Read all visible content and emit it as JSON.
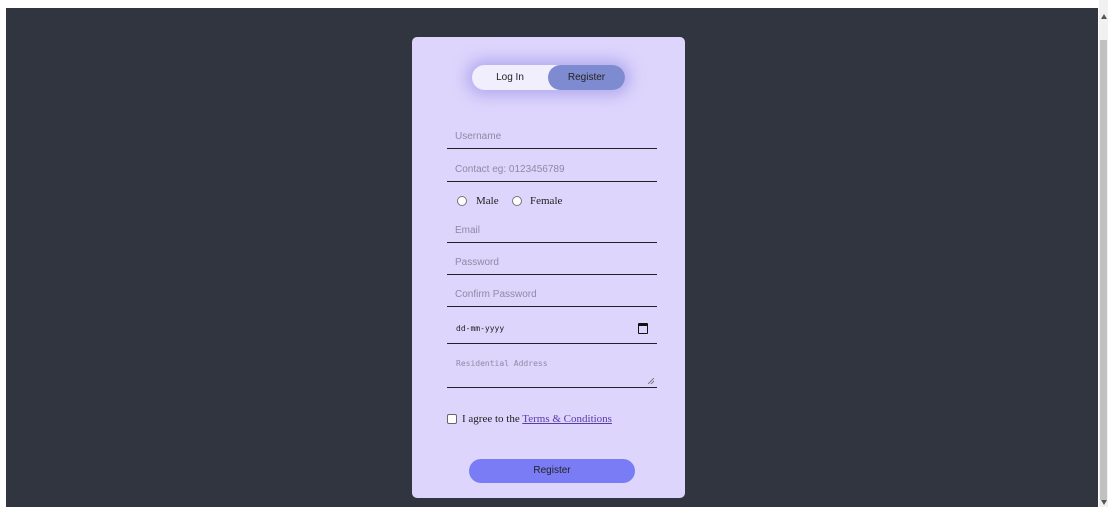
{
  "toggle": {
    "login_label": "Log In",
    "register_label": "Register"
  },
  "form": {
    "username_placeholder": "Username",
    "contact_placeholder": "Contact eg: 0123456789",
    "gender": {
      "male_label": "Male",
      "female_label": "Female"
    },
    "email_placeholder": "Email",
    "password_placeholder": "Password",
    "confirm_password_placeholder": "Confirm Password",
    "date_placeholder": "dd-mm-yyyy",
    "address_placeholder": "Residential Address",
    "terms_prefix": "I agree to the",
    "terms_link": "Terms & Conditions",
    "submit_label": "Register"
  },
  "colors": {
    "background": "#31353f",
    "card": "#ddd5fc",
    "toggle_active": "#7e8bd0",
    "submit": "#7a7cf5"
  },
  "icons": {
    "date": "calendar-icon",
    "textarea_resize": "resize-grip-icon"
  }
}
